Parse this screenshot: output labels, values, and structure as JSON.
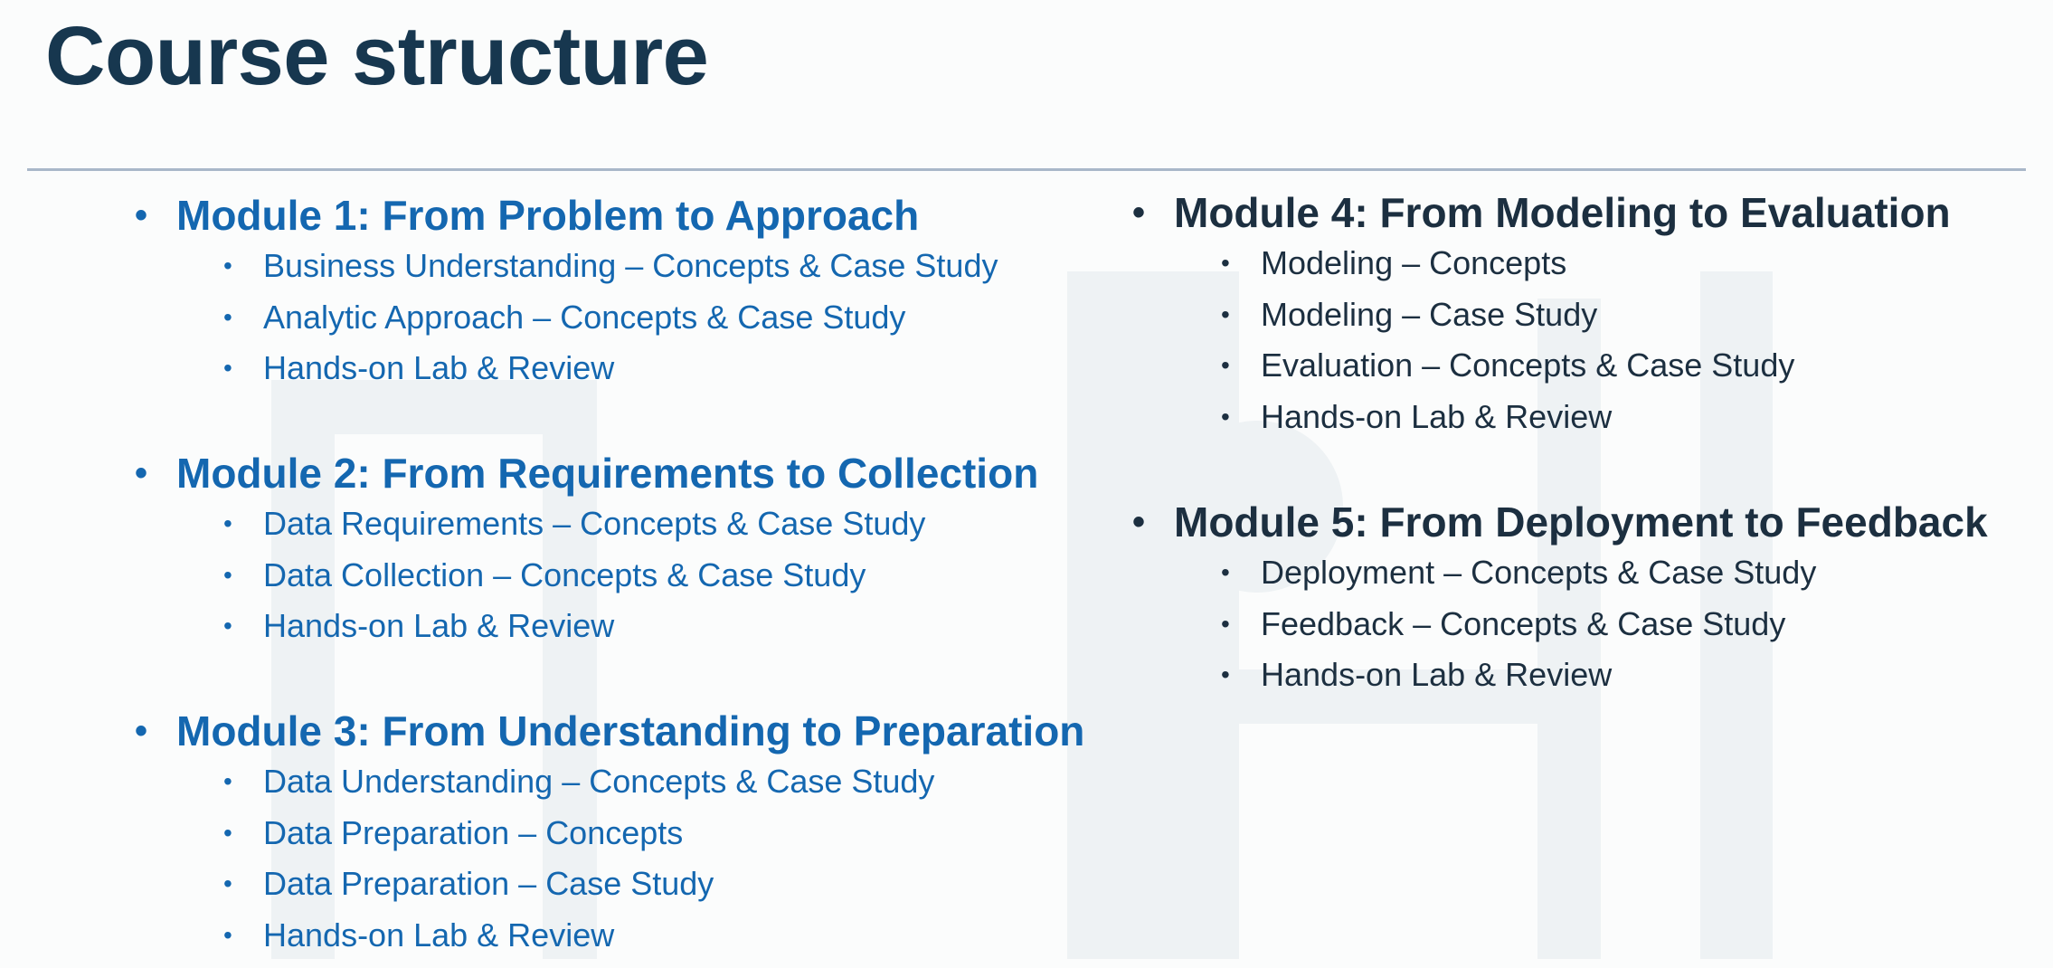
{
  "slide": {
    "title": "Course structure"
  },
  "colors": {
    "title": "#17374f",
    "rule": "#a9b7c9",
    "left_column_text": "#1467b0",
    "right_column_text": "#1c2f40",
    "background": "#fbfcfc",
    "watermark": "#eef2f4"
  },
  "bullets": {
    "major": "•",
    "minor": "•"
  },
  "modules": [
    {
      "heading": "Module 1: From Problem to Approach",
      "topics": [
        "Business Understanding – Concepts & Case Study",
        "Analytic Approach – Concepts & Case Study",
        "Hands-on Lab & Review"
      ]
    },
    {
      "heading": "Module 2: From Requirements to Collection",
      "topics": [
        "Data Requirements – Concepts & Case Study",
        "Data Collection – Concepts & Case Study",
        "Hands-on Lab & Review"
      ]
    },
    {
      "heading": "Module 3: From Understanding to Preparation",
      "topics": [
        "Data Understanding – Concepts & Case Study",
        "Data Preparation – Concepts",
        "Data Preparation – Case Study",
        "Hands-on Lab & Review"
      ]
    },
    {
      "heading": "Module 4: From Modeling to Evaluation",
      "topics": [
        "Modeling – Concepts",
        "Modeling – Case Study",
        "Evaluation – Concepts & Case Study",
        "Hands-on Lab & Review"
      ]
    },
    {
      "heading": "Module 5: From Deployment to Feedback",
      "topics": [
        "Deployment – Concepts & Case Study",
        "Feedback – Concepts & Case Study",
        "Hands-on Lab & Review"
      ]
    }
  ]
}
